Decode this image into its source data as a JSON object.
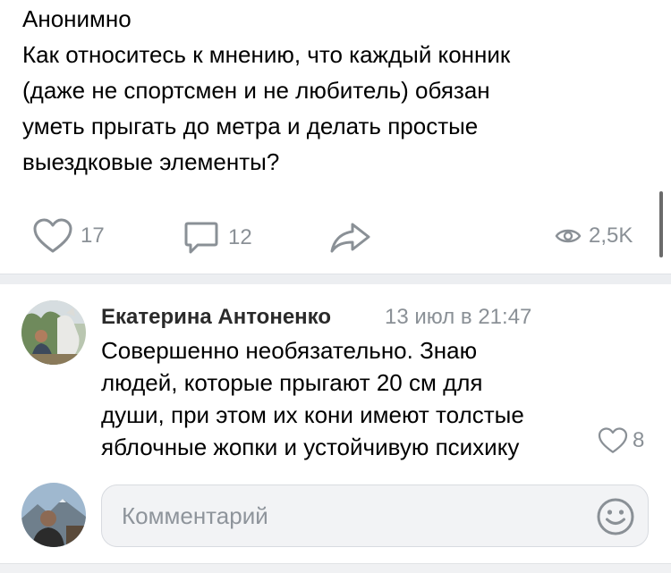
{
  "post": {
    "author": "Анонимно",
    "text": "Как относитесь к мнению, что каждый конник\n(даже не спортсмен и не любитель) обязан\nуметь прыгать до метра и делать простые\nвыездковые элементы?",
    "likes": "17",
    "comments": "12",
    "views": "2,5K"
  },
  "comment": {
    "author": "Екатерина Антоненко",
    "time": "13 июл в 21:47",
    "text": "Совершенно необязательно. Знаю\nлюдей, которые прыгают 20 см для\nдуши, при этом их кони имеют толстые\nяблочные жопки и устойчивую психику",
    "likes": "8"
  },
  "reply": {
    "placeholder": "Комментарий"
  },
  "icons": {
    "like": "heart-outline-icon",
    "comment": "comment-bubble-icon",
    "share": "share-arrow-icon",
    "views": "eye-icon",
    "emoji": "smiley-icon"
  },
  "colors": {
    "icon_gray": "#8a9096",
    "divider": "#eceef1",
    "input_bg": "#f2f3f5"
  }
}
